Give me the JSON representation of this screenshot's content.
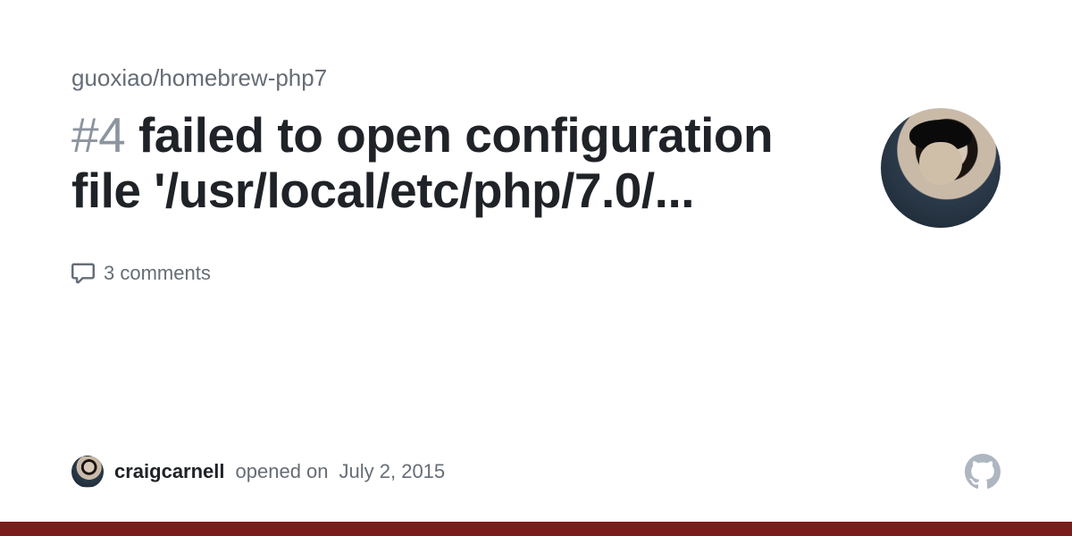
{
  "repo": "guoxiao/homebrew-php7",
  "issue": {
    "number": "#4",
    "title": "failed to open configuration file '/usr/local/etc/php/7.0/...",
    "comments_label": "3 comments"
  },
  "author": {
    "username": "craigcarnell",
    "action": "opened on",
    "date": "July 2, 2015"
  }
}
